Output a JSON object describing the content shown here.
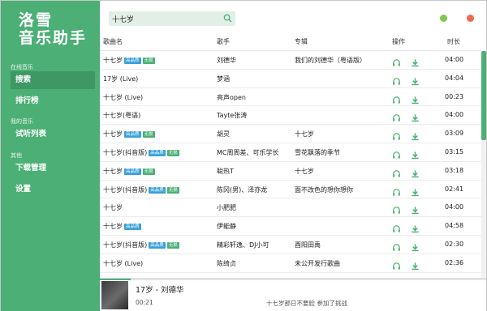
{
  "app": {
    "title_line1": "洛雪",
    "title_line2": "音乐助手"
  },
  "sidebar": {
    "section_online": "在线音乐",
    "section_mine": "我的音乐",
    "section_other": "其他",
    "items": [
      {
        "label": "搜索",
        "active": true
      },
      {
        "label": "排行榜",
        "active": false
      },
      {
        "label": "试听列表",
        "active": false
      },
      {
        "label": "下载管理",
        "active": false
      },
      {
        "label": "设置",
        "active": false
      }
    ]
  },
  "search": {
    "value": "十七岁",
    "icon": "search-icon"
  },
  "window_controls": {
    "minimize_color": "#7ec84a",
    "close_color": "#ee6a4d"
  },
  "table": {
    "headers": {
      "song": "歌曲名",
      "artist": "歌手",
      "album": "专辑",
      "action": "操作",
      "duration": "时长"
    },
    "tag_hq": "高品质",
    "tag_nl": "无损",
    "rows": [
      {
        "song": "十七岁",
        "hq": true,
        "nl": true,
        "artist": "刘德华",
        "album": "我们的刘德华（粤语版）",
        "duration": "04:00"
      },
      {
        "song": "17岁 (Live)",
        "hq": false,
        "nl": false,
        "artist": "梦涵",
        "album": "",
        "duration": "04:04"
      },
      {
        "song": "十七岁 (Live)",
        "hq": false,
        "nl": false,
        "artist": "亮声open",
        "album": "",
        "duration": "00:23"
      },
      {
        "song": "十七岁(粤语)",
        "hq": false,
        "nl": false,
        "artist": "Tayte张涛",
        "album": "",
        "duration": "04:00"
      },
      {
        "song": "十七岁",
        "hq": true,
        "nl": true,
        "artist": "胡灵",
        "album": "十七岁",
        "duration": "03:09"
      },
      {
        "song": "十七岁(抖音版)",
        "hq": true,
        "nl": true,
        "artist": "MC周周差、可乐学长",
        "album": "雪花飘落的季节",
        "duration": "03:15"
      },
      {
        "song": "十七岁",
        "hq": true,
        "nl": true,
        "artist": "聪热T",
        "album": "十七岁",
        "duration": "03:18"
      },
      {
        "song": "十七岁(抖音版)",
        "hq": true,
        "nl": true,
        "artist": "陈冈(男)、泽亦龙",
        "album": "面不改色的想你想你",
        "duration": "02:41"
      },
      {
        "song": "十七岁",
        "hq": false,
        "nl": false,
        "artist": "小肥肥",
        "album": "",
        "duration": "04:00"
      },
      {
        "song": "十七岁",
        "hq": true,
        "nl": false,
        "artist": "伊能静",
        "album": "",
        "duration": "04:58"
      },
      {
        "song": "十七岁(抖音版)",
        "hq": true,
        "nl": true,
        "artist": "精彩轩逸、DJ小可",
        "album": "酉阳田禹",
        "duration": "02:30"
      },
      {
        "song": "十七岁 (Live)",
        "hq": false,
        "nl": false,
        "artist": "陈绮贞",
        "album": "未公开发行歌曲",
        "duration": "02:36"
      }
    ]
  },
  "player": {
    "now_playing": "17岁 - 刘德华",
    "time": "00:21",
    "lyric": "十七岁那日不要脸 参加了挑战",
    "progress": 0.08
  },
  "colors": {
    "accent": "#4caf76",
    "accent_dark": "#3d9863",
    "tag_hq": "#3aa0d8"
  }
}
